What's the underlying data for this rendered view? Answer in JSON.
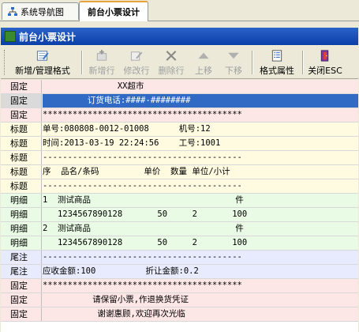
{
  "tabs": [
    {
      "label": "系统导航图",
      "icon": "sitemap-icon"
    },
    {
      "label": "前台小票设计",
      "active": true
    }
  ],
  "window": {
    "title": "前台小票设计"
  },
  "toolbar": {
    "new_format": "新增/管理格式",
    "add_row": "新增行",
    "edit_row": "修改行",
    "delete_row": "删除行",
    "move_up": "上移",
    "move_down": "下移",
    "format_props": "格式属性",
    "close": "关闭ESC"
  },
  "rows": [
    {
      "type": "固定",
      "kind": "fixed",
      "text": "               XX超市"
    },
    {
      "type": "固定",
      "kind": "fixed",
      "selected": true,
      "text": "         订货电话:####-########"
    },
    {
      "type": "固定",
      "kind": "fixed",
      "text": "****************************************"
    },
    {
      "type": "标题",
      "kind": "title",
      "text": "单号:080808-0012-01008      机号:12"
    },
    {
      "type": "标题",
      "kind": "title",
      "text": "时间:2013-03-19 22:24:56    工号:1001"
    },
    {
      "type": "标题",
      "kind": "title",
      "text": "----------------------------------------"
    },
    {
      "type": "标题",
      "kind": "title",
      "text": "序  品名/条码         单价  数量 单位/小计"
    },
    {
      "type": "标题",
      "kind": "title",
      "text": "----------------------------------------"
    },
    {
      "type": "明细",
      "kind": "detail",
      "text": "1  测试商品                             件"
    },
    {
      "type": "明细",
      "kind": "detail",
      "text": "   1234567890128       50     2       100"
    },
    {
      "type": "明细",
      "kind": "detail",
      "text": "2  测试商品                             件"
    },
    {
      "type": "明细",
      "kind": "detail",
      "text": "   1234567890128       50     2       100"
    },
    {
      "type": "尾注",
      "kind": "footer",
      "text": "----------------------------------------"
    },
    {
      "type": "尾注",
      "kind": "footer",
      "text": "应收金额:100          折让金额:0.2"
    },
    {
      "type": "固定",
      "kind": "fixed",
      "text": "****************************************"
    },
    {
      "type": "固定",
      "kind": "fixed",
      "text": "          请保留小票,作退换货凭证"
    },
    {
      "type": "固定",
      "kind": "fixed",
      "text": "           谢谢惠顾,欢迎再次光临"
    }
  ]
}
